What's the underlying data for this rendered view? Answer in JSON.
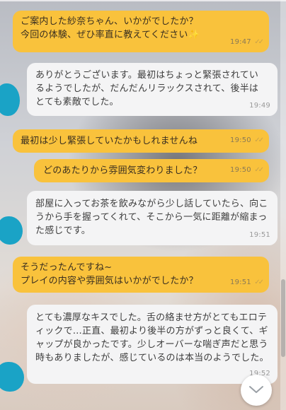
{
  "messages": [
    {
      "dir": "sent",
      "text": "ご案内した紗奈ちゃん、いかがでしたか？\n今回の体験、ぜひ率直に教えてください✨",
      "time": "19:47",
      "ticks": "✓✓"
    },
    {
      "dir": "recv",
      "text": "ありがとうございます。最初はちょっと緊張されているようでしたが、だんだんリラックスされて、後半はとても素敵でした。",
      "time": "19:49"
    },
    {
      "dir": "sent",
      "text": "最初は少し緊張していたかもしれませんね",
      "time": "19:50",
      "ticks": "✓✓"
    },
    {
      "dir": "sent",
      "text": "どのあたりから雰囲気変わりました？",
      "time": "19:50",
      "ticks": "✓✓"
    },
    {
      "dir": "recv",
      "text": "部屋に入ってお茶を飲みながら少し話していたら、向こうから手を握ってくれて、そこから一気に距離が縮まった感じです。",
      "time": "19:51"
    },
    {
      "dir": "sent",
      "text": "そうだったんですね~\nプレイの内容や雰囲気はいかがでしたか？",
      "time": "19:51",
      "ticks": "✓✓"
    },
    {
      "dir": "recv",
      "text": "とても濃厚なキスでした。舌の絡ませ方がとてもエロティックで…正直、最初より後半の方がずっと良くて、ギャップが良かったです。少しオーバーな喘ぎ声だと思う時もありましたが、感じているのは本当のようでした。",
      "time": "19:52"
    }
  ],
  "colors": {
    "sent_bubble": "#f9c23c",
    "recv_bubble": "#f4f4f5",
    "avatar_blob": "#1aa3c6"
  },
  "icons": {
    "scroll_down": "chevron-down-icon",
    "read_receipt": "double-check-icon"
  }
}
